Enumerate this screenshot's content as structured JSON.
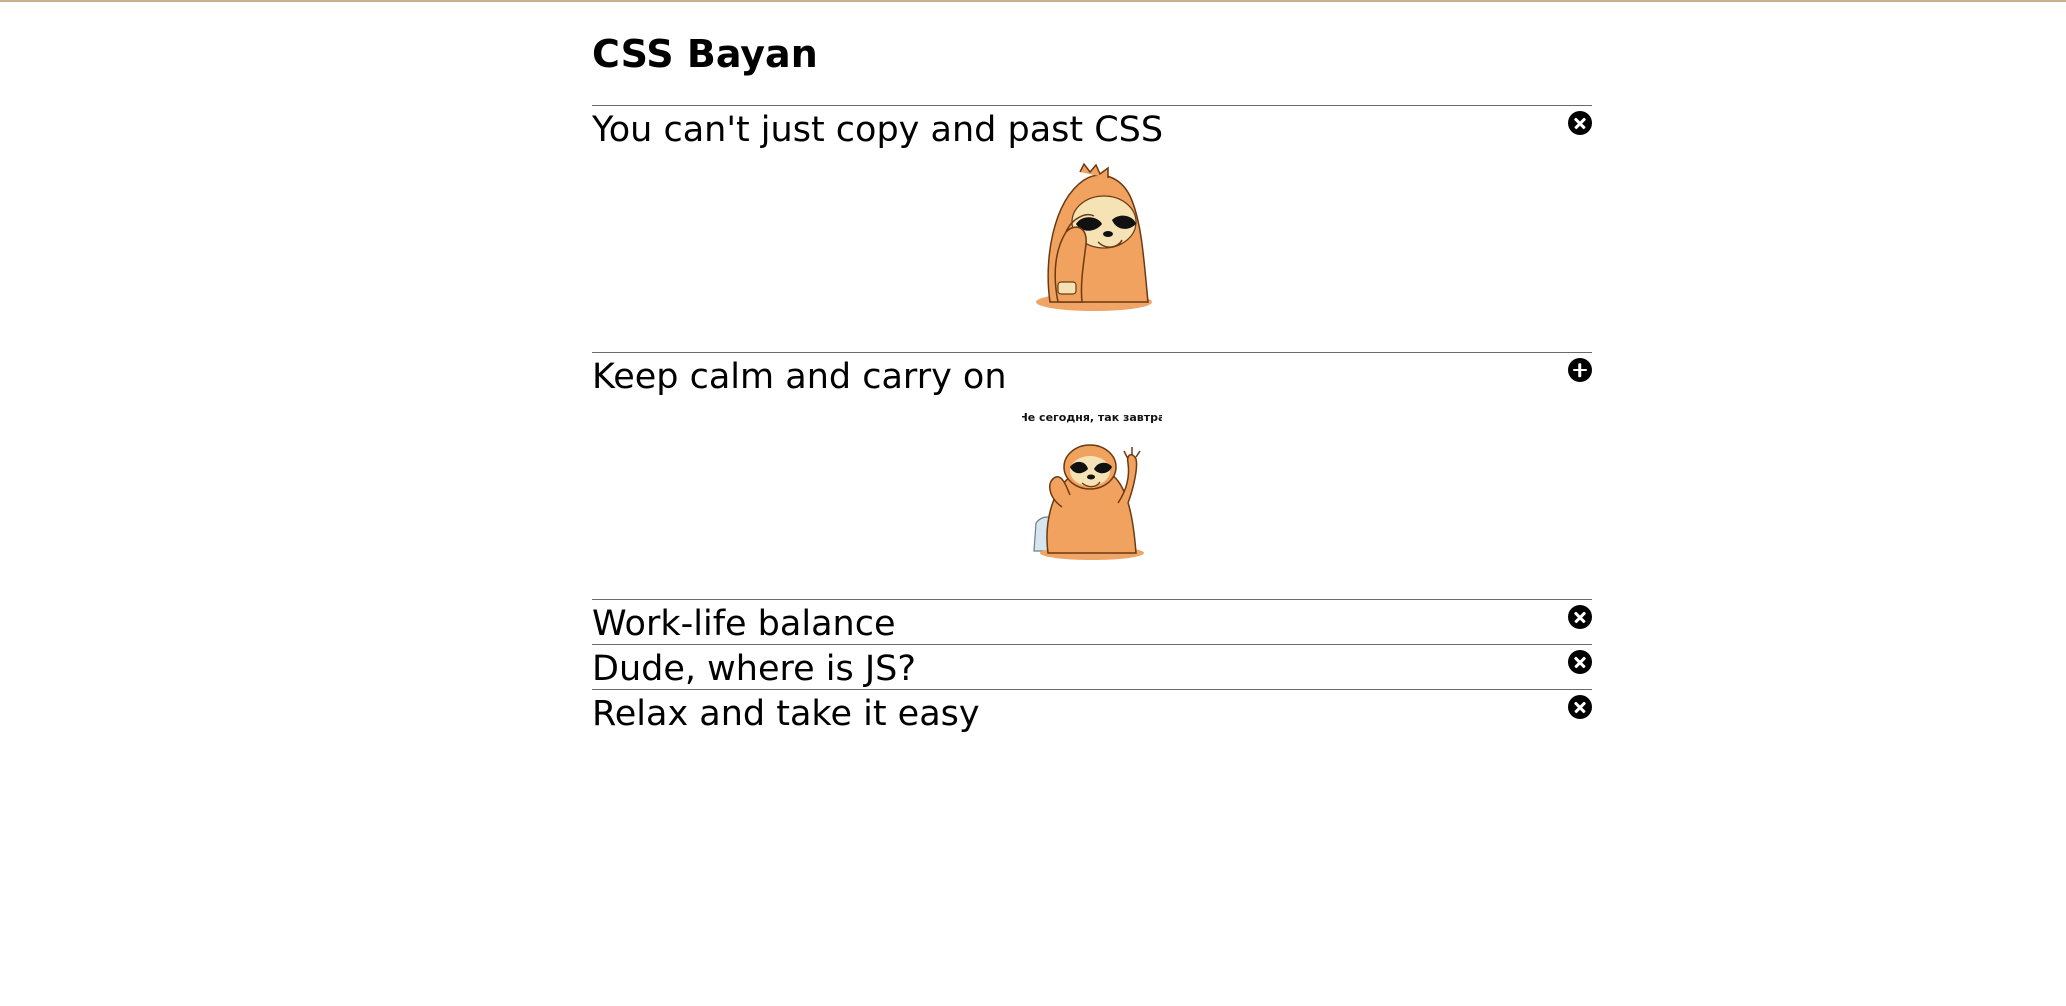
{
  "page": {
    "title": "CSS Bayan",
    "accent_color": "#c9b18e"
  },
  "accordion": {
    "items": [
      {
        "title": "You can't just copy and past CSS",
        "expanded": true,
        "icon": "close-icon",
        "image": "sloth-facepalm-sticker"
      },
      {
        "title": "Keep calm and carry on",
        "expanded": true,
        "icon": "plus-icon",
        "image": "sloth-relax-sticker",
        "image_caption": "Не сегодня, так завтра"
      },
      {
        "title": "Work-life balance",
        "expanded": false,
        "icon": "close-icon"
      },
      {
        "title": "Dude, where is JS?",
        "expanded": false,
        "icon": "close-icon"
      },
      {
        "title": "Relax and take it easy",
        "expanded": false,
        "icon": "close-icon"
      }
    ]
  }
}
